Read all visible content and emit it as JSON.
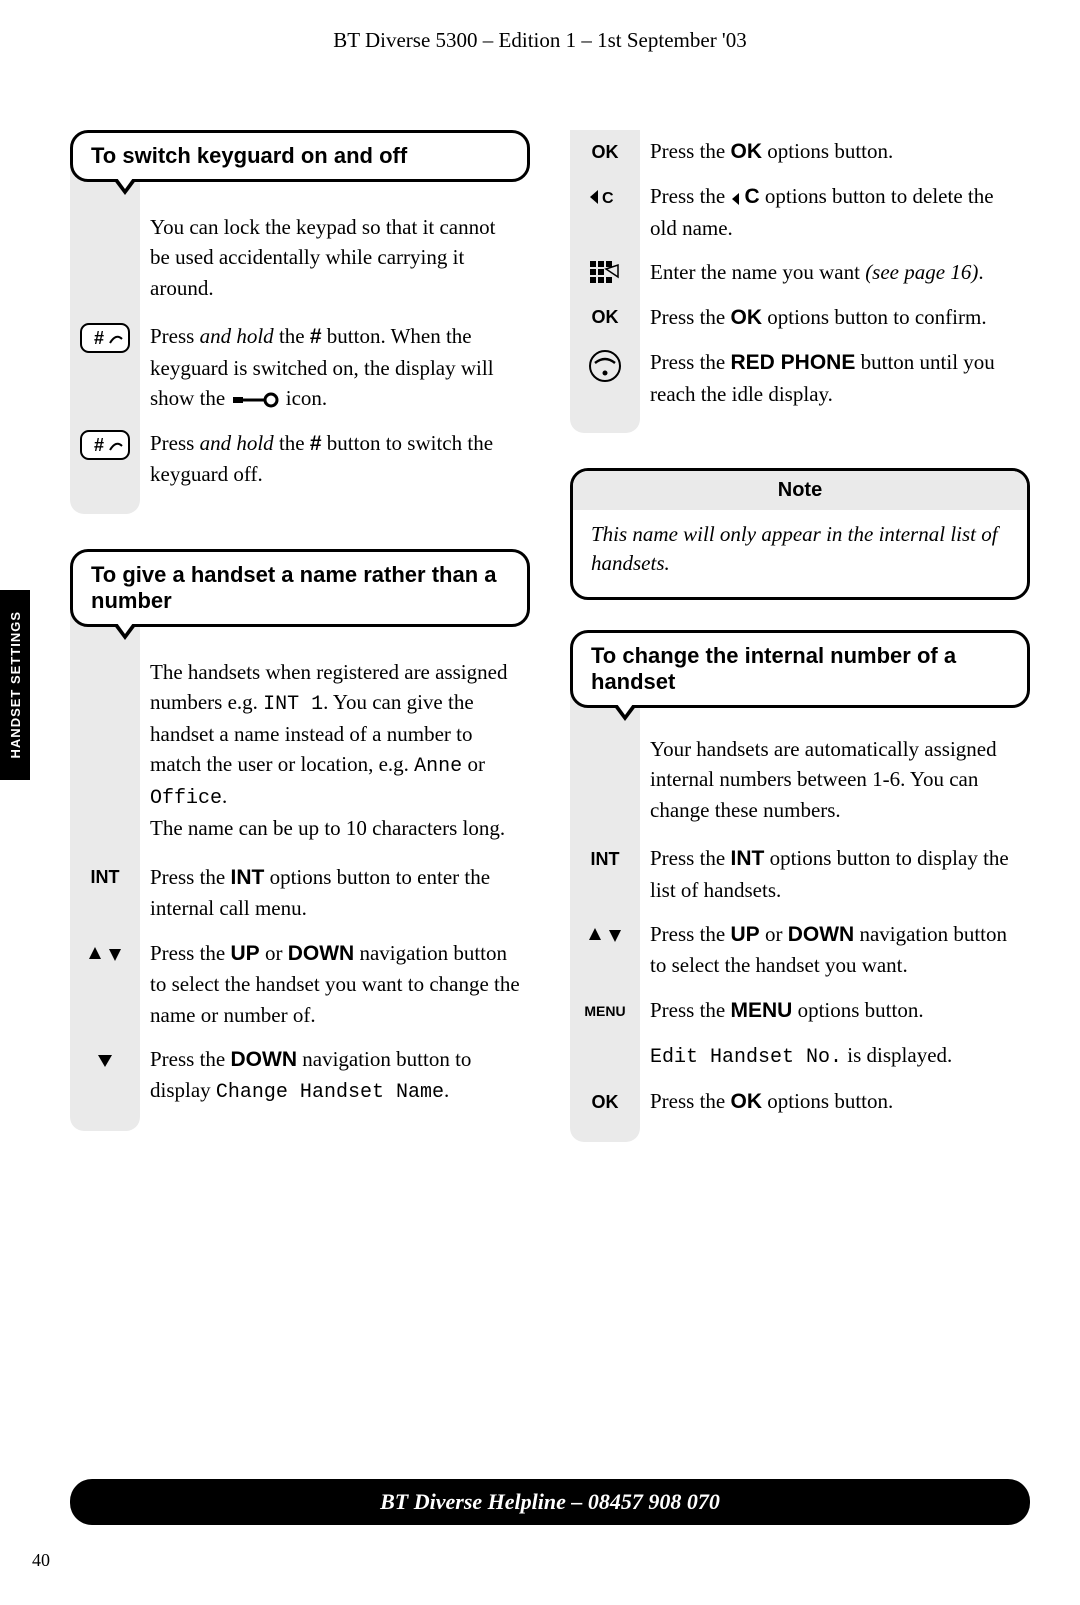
{
  "header": "BT Diverse 5300 – Edition 1 – 1st September '03",
  "side_tab": "HANDSET SETTINGS",
  "page_number": "40",
  "footer": "BT Diverse Helpline – 08457 908 070",
  "section1": {
    "title": "To switch keyguard on and off",
    "intro": "You can lock the keypad so that it cannot be used accidentally while carrying it around.",
    "s1_a": "Press ",
    "s1_b": "and hold",
    "s1_c": " the ",
    "s1_hash": "#",
    "s1_d": " button. When the keyguard is switched on, the display will show the ",
    "s1_e": " icon.",
    "s2_a": "Press ",
    "s2_b": "and hold",
    "s2_c": " the ",
    "s2_d": " button to switch the keyguard off."
  },
  "section2": {
    "title": "To give a handset a name rather than a number",
    "intro_a": "The handsets when registered are assigned numbers e.g. ",
    "intro_int1": "INT 1",
    "intro_b": ". You can give the handset a name instead of a number to match the user or location, e.g. ",
    "intro_anne": "Anne",
    "intro_or": " or ",
    "intro_office": "Office",
    "intro_c": ".",
    "intro_d": "The name can be up to 10 characters long.",
    "int_label": "INT",
    "s1_a": "Press the ",
    "s1_b": "INT",
    "s1_c": " options button to enter the internal call menu.",
    "s2_a": "Press the ",
    "s2_b": "UP",
    "s2_c": " or ",
    "s2_d": "DOWN",
    "s2_e": " navigation button to select the handset you want to change the name or number of.",
    "s3_a": "Press the ",
    "s3_b": "DOWN",
    "s3_c": " navigation button to display ",
    "s3_d": "Change Handset Name",
    "s3_e": "."
  },
  "right_top": {
    "ok1_a": "Press the ",
    "ok1_b": "OK",
    "ok1_c": " options button.",
    "c_a": "Press the ",
    "c_b": "C",
    "c_c": " options button to delete the old name.",
    "kp_a": "Enter the name you want ",
    "kp_b": "(see page 16)",
    "kp_c": ".",
    "ok2_a": "Press the ",
    "ok2_b": "OK",
    "ok2_c": " options button to confirm.",
    "ph_a": "Press the ",
    "ph_b": "RED PHONE",
    "ph_c": " button until you reach the idle display.",
    "ok_label": "OK",
    "c_label": "C"
  },
  "note": {
    "title": "Note",
    "body": "This name will only appear in the internal list of handsets."
  },
  "section3": {
    "title": "To change the internal number of a handset",
    "intro": "Your handsets are automatically assigned internal numbers between 1-6. You can change these numbers.",
    "int_label": "INT",
    "menu_label": "MENU",
    "ok_label": "OK",
    "s1_a": "Press the ",
    "s1_b": "INT",
    "s1_c": " options button to display the list of handsets.",
    "s2_a": "Press the ",
    "s2_b": "UP",
    "s2_c": " or ",
    "s2_d": "DOWN",
    "s2_e": " navigation button to select the handset you want.",
    "s3_a": "Press the ",
    "s3_b": "MENU",
    "s3_c": " options button.",
    "s4_a": "Edit Handset No.",
    "s4_b": " is displayed.",
    "s5_a": "Press the ",
    "s5_b": "OK",
    "s5_c": " options button."
  }
}
